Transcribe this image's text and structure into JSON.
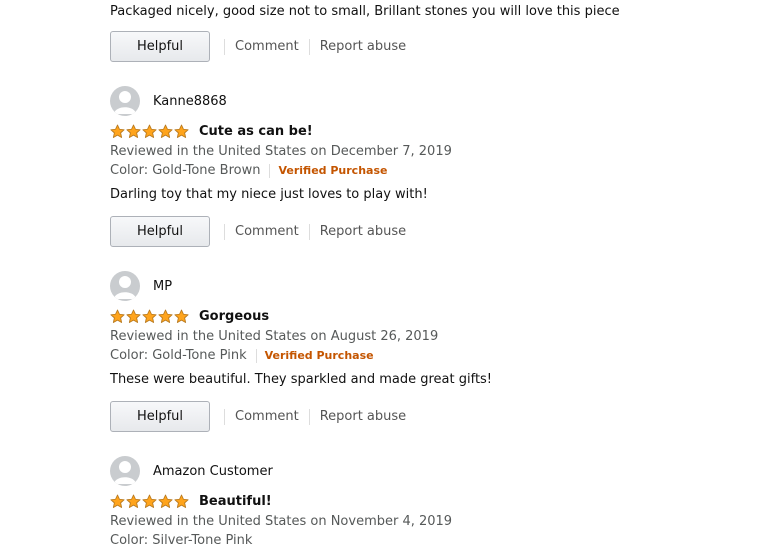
{
  "top_review": {
    "text": "Packaged nicely, good size not to small, Brillant stones you will love this piece",
    "helpful_label": "Helpful",
    "comment_label": "Comment",
    "report_label": "Report abuse"
  },
  "reviews": [
    {
      "name": "Kanne8868",
      "rating": 5,
      "title": "Cute as can be!",
      "date": "Reviewed in the United States on December 7, 2019",
      "color": "Color: Gold-Tone Brown",
      "verified": "Verified Purchase",
      "body": "Darling toy that my niece just loves to play with!",
      "helpful_label": "Helpful",
      "comment_label": "Comment",
      "report_label": "Report abuse"
    },
    {
      "name": "MP",
      "rating": 5,
      "title": "Gorgeous",
      "date": "Reviewed in the United States on August 26, 2019",
      "color": "Color: Gold-Tone Pink",
      "verified": "Verified Purchase",
      "body": "These were beautiful. They sparkled and made great gifts!",
      "helpful_label": "Helpful",
      "comment_label": "Comment",
      "report_label": "Report abuse"
    },
    {
      "name": "Amazon Customer",
      "rating": 5,
      "title": "Beautiful!",
      "date": "Reviewed in the United States on November 4, 2019",
      "color": "Color: Silver-Tone Pink"
    }
  ],
  "colors": {
    "star": "#ffa41c",
    "verified": "#c45500",
    "muted_text": "#565959",
    "avatar_bg": "#c9cccf"
  }
}
